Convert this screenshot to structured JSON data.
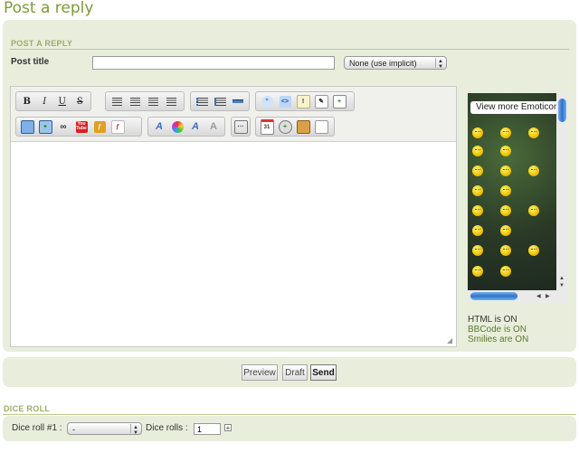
{
  "page": {
    "title": "Post a reply"
  },
  "form": {
    "section_title": "POST A REPLY",
    "post_title_label": "Post title",
    "post_title_value": "",
    "icon_select": "None (use implicit)"
  },
  "toolbar": {
    "bold": "B",
    "italic": "I",
    "underline": "U",
    "strike": "S",
    "youtube": "You Tube"
  },
  "emoticons": {
    "header": "View more Emoticons"
  },
  "status": {
    "html": "HTML is ON",
    "bbcode": "BBCode is ON",
    "smilies": "Smilies are ON"
  },
  "actions": {
    "preview": "Preview",
    "draft": "Draft",
    "send": "Send"
  },
  "dice": {
    "section_title": "DICE ROLL",
    "roll_label": "Dice roll #1 :",
    "roll_select": "-",
    "rolls_label": "Dice rolls :",
    "rolls_value": "1"
  },
  "icons": [
    "bold-icon",
    "italic-icon",
    "underline-icon",
    "strikethrough-icon",
    "align-left-icon",
    "align-center-icon",
    "align-right-icon",
    "justify-icon",
    "bullet-list-icon",
    "numbered-list-icon",
    "horizontal-rule-icon",
    "quote-icon",
    "code-icon",
    "spoiler-icon",
    "edit-icon",
    "table-icon",
    "image-icon",
    "upload-image-icon",
    "link-icon",
    "youtube-icon",
    "flash-icon",
    "pdf-icon",
    "font-icon",
    "color-icon",
    "font-size-icon",
    "clear-format-icon",
    "more-icon",
    "date-icon",
    "search-icon",
    "paste-icon",
    "paste-text-icon",
    "plus-icon"
  ],
  "colors": {
    "accent_green": "#7c9a38",
    "panel_bg": "#e9eddc",
    "section_header": "#9aad6a",
    "status_link": "#5a7a2e"
  }
}
